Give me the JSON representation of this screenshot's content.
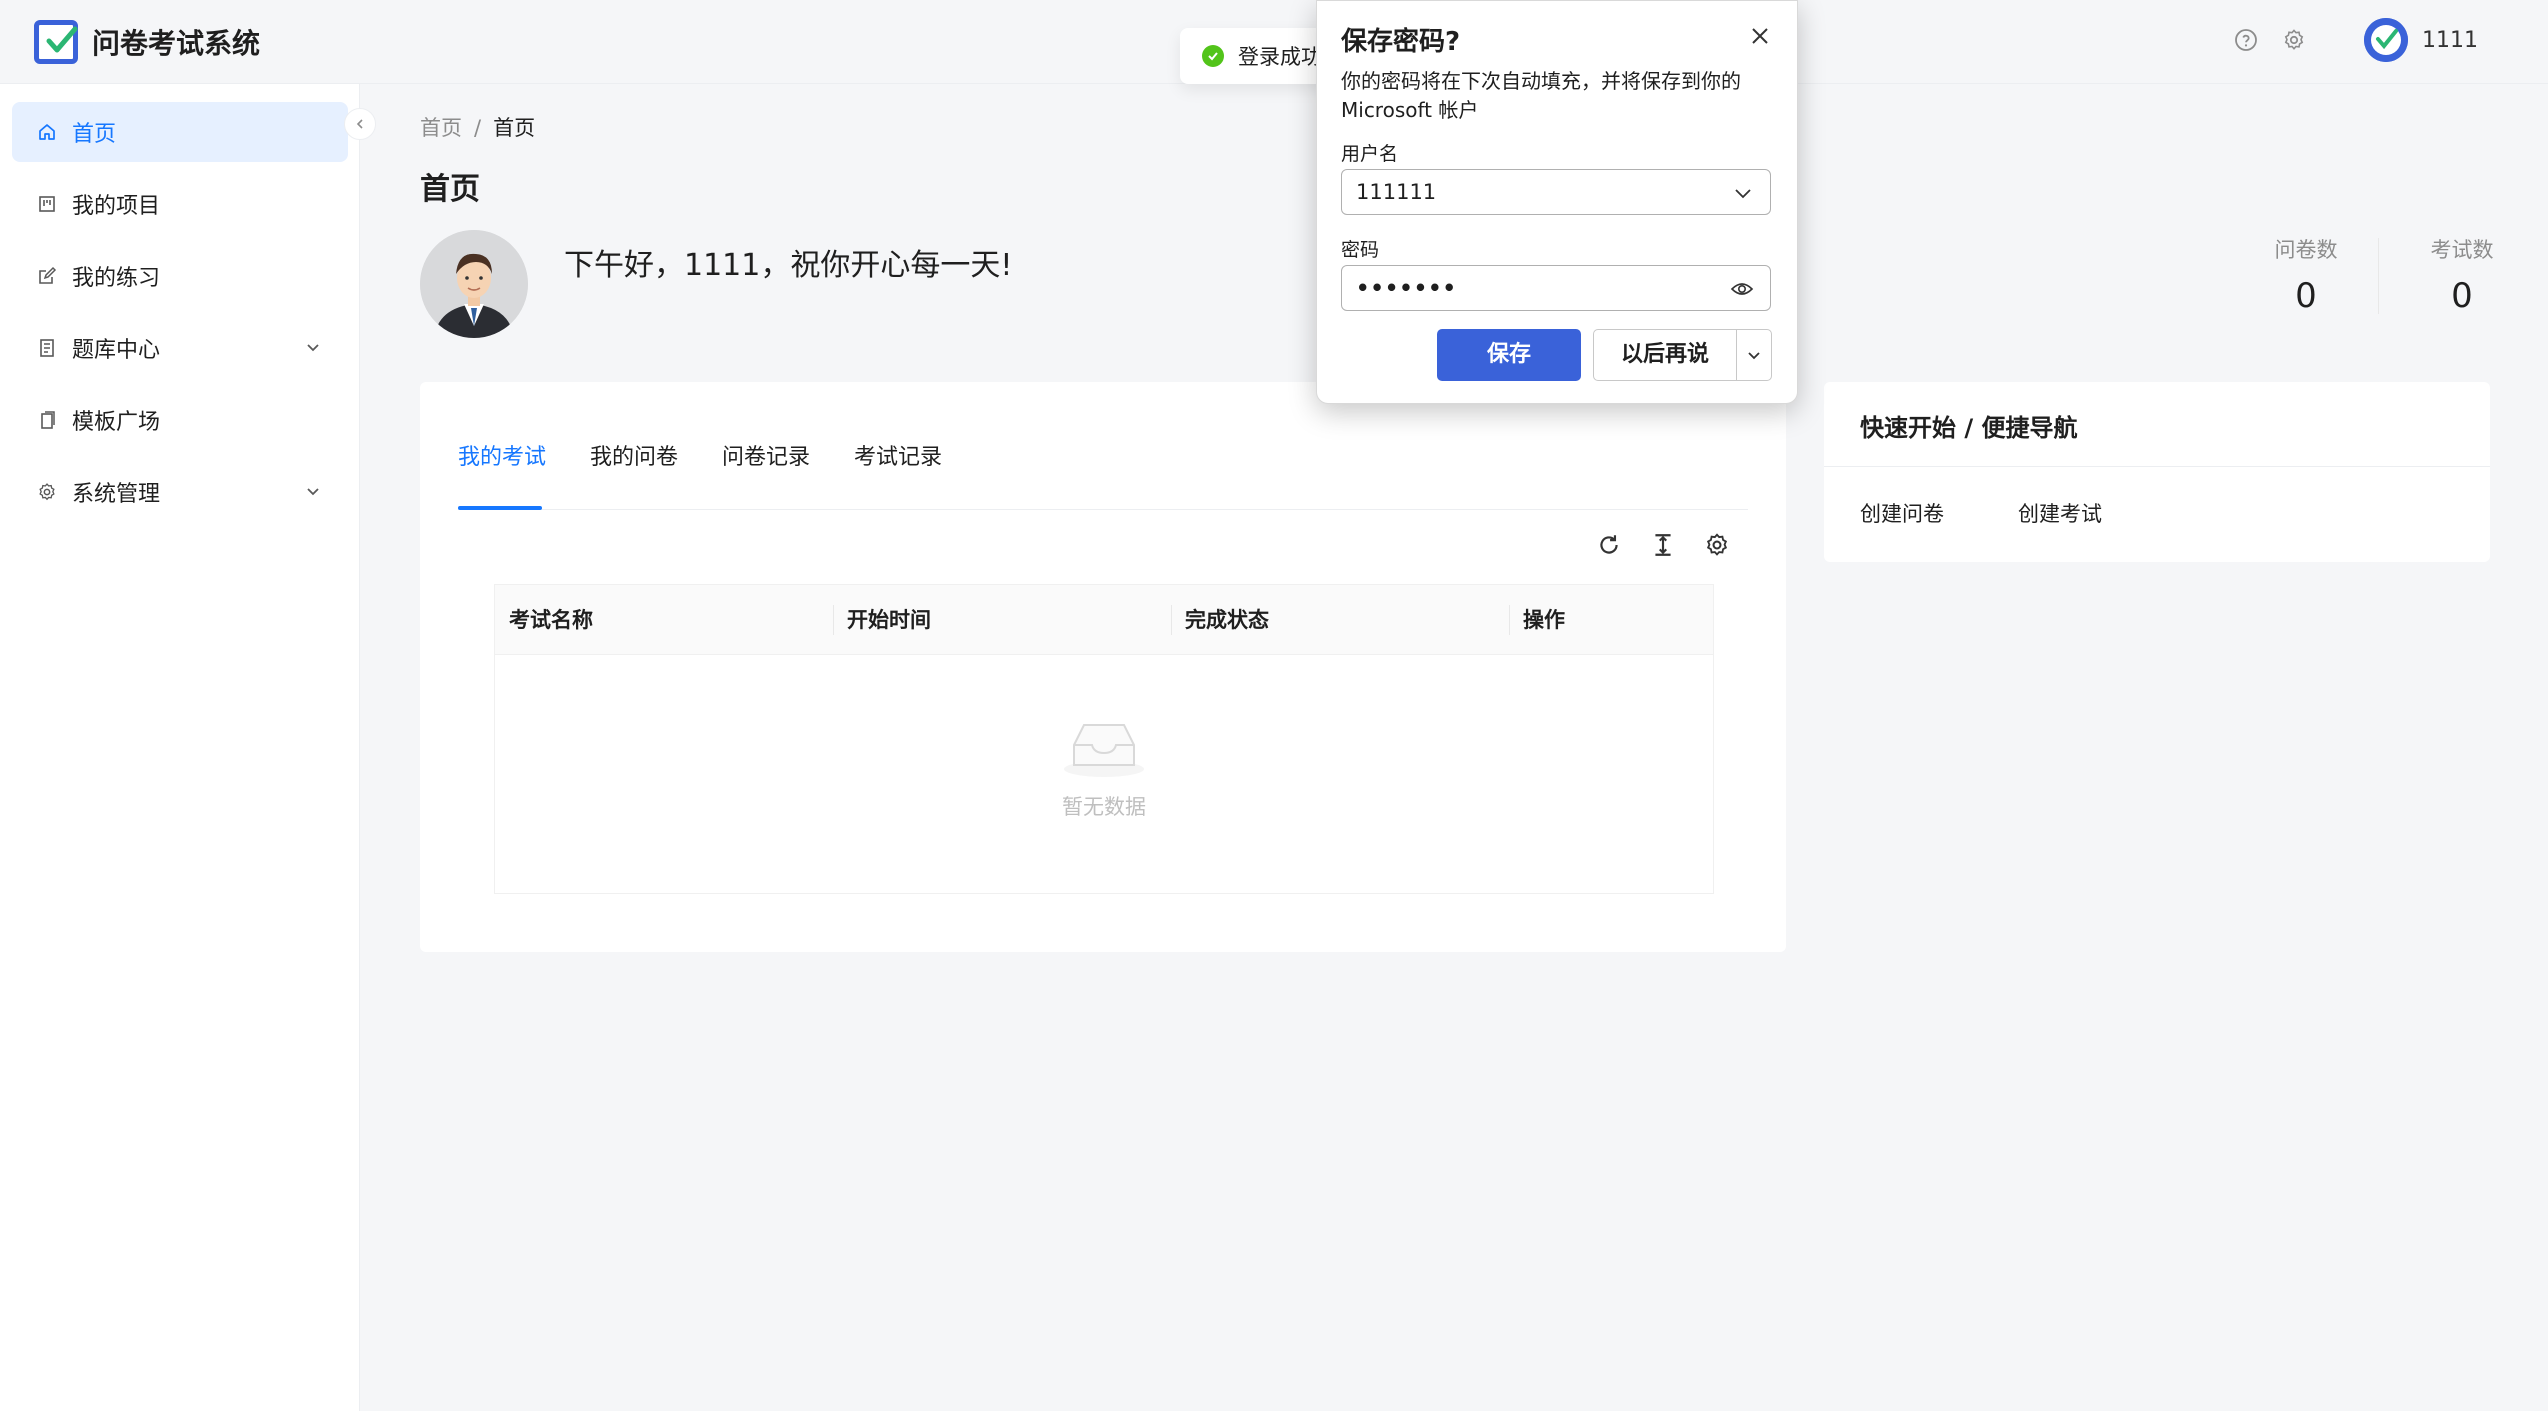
{
  "app": {
    "title": "问卷考试系统",
    "user_name": "1111"
  },
  "header": {
    "icons": [
      "help-icon",
      "gear-icon"
    ]
  },
  "sidebar": {
    "items": [
      {
        "label": "首页",
        "icon": "home-icon",
        "active": true
      },
      {
        "label": "我的项目",
        "icon": "project-icon"
      },
      {
        "label": "我的练习",
        "icon": "edit-icon"
      },
      {
        "label": "题库中心",
        "icon": "book-icon",
        "expandable": true
      },
      {
        "label": "模板广场",
        "icon": "copy-icon"
      },
      {
        "label": "系统管理",
        "icon": "gear-icon",
        "expandable": true
      }
    ]
  },
  "breadcrumb": {
    "root": "首页",
    "sep": "/",
    "current": "首页"
  },
  "page": {
    "title": "首页",
    "greeting": "下午好，1111，祝你开心每一天!"
  },
  "stats": [
    {
      "label": "问卷数",
      "value": "0"
    },
    {
      "label": "考试数",
      "value": "0"
    }
  ],
  "tabs": [
    "我的考试",
    "我的问卷",
    "问卷记录",
    "考试记录"
  ],
  "table": {
    "columns": [
      "考试名称",
      "开始时间",
      "完成状态",
      "操作"
    ],
    "empty_text": "暂无数据"
  },
  "quick_nav": {
    "title": "快速开始 / 便捷导航",
    "links": [
      "创建问卷",
      "创建考试"
    ]
  },
  "toast": {
    "text": "登录成功"
  },
  "password_dialog": {
    "title": "保存密码?",
    "description": "你的密码将在下次自动填充，并将保存到你的 Microsoft 帐户",
    "username_label": "用户名",
    "username_value": "111111",
    "password_label": "密码",
    "password_value": "•••••••",
    "save_label": "保存",
    "later_label": "以后再说"
  },
  "colors": {
    "accent": "#1677ff",
    "brand": "#3a62d9",
    "success": "#52c41a"
  }
}
